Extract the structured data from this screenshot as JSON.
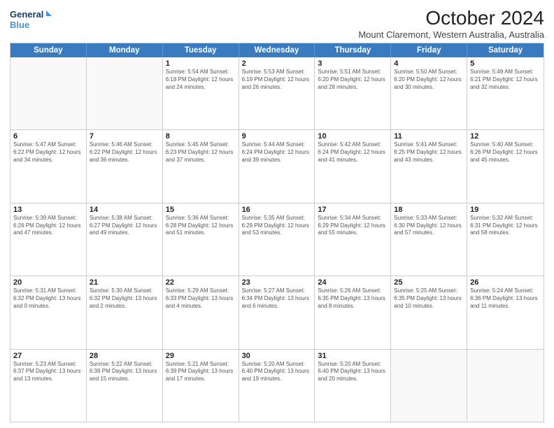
{
  "logo": {
    "line1": "General",
    "line2": "Blue",
    "icon_color": "#4a90d9"
  },
  "title": "October 2024",
  "subtitle": "Mount Claremont, Western Australia, Australia",
  "days": [
    "Sunday",
    "Monday",
    "Tuesday",
    "Wednesday",
    "Thursday",
    "Friday",
    "Saturday"
  ],
  "weeks": [
    [
      {
        "day": "",
        "info": ""
      },
      {
        "day": "",
        "info": ""
      },
      {
        "day": "1",
        "info": "Sunrise: 5:54 AM\nSunset: 6:18 PM\nDaylight: 12 hours and 24 minutes."
      },
      {
        "day": "2",
        "info": "Sunrise: 5:53 AM\nSunset: 6:19 PM\nDaylight: 12 hours and 26 minutes."
      },
      {
        "day": "3",
        "info": "Sunrise: 5:51 AM\nSunset: 6:20 PM\nDaylight: 12 hours and 28 minutes."
      },
      {
        "day": "4",
        "info": "Sunrise: 5:50 AM\nSunset: 6:20 PM\nDaylight: 12 hours and 30 minutes."
      },
      {
        "day": "5",
        "info": "Sunrise: 5:49 AM\nSunset: 6:21 PM\nDaylight: 12 hours and 32 minutes."
      }
    ],
    [
      {
        "day": "6",
        "info": "Sunrise: 5:47 AM\nSunset: 6:22 PM\nDaylight: 12 hours and 34 minutes."
      },
      {
        "day": "7",
        "info": "Sunrise: 5:46 AM\nSunset: 6:22 PM\nDaylight: 12 hours and 36 minutes."
      },
      {
        "day": "8",
        "info": "Sunrise: 5:45 AM\nSunset: 6:23 PM\nDaylight: 12 hours and 37 minutes."
      },
      {
        "day": "9",
        "info": "Sunrise: 5:44 AM\nSunset: 6:24 PM\nDaylight: 12 hours and 39 minutes."
      },
      {
        "day": "10",
        "info": "Sunrise: 5:42 AM\nSunset: 6:24 PM\nDaylight: 12 hours and 41 minutes."
      },
      {
        "day": "11",
        "info": "Sunrise: 5:41 AM\nSunset: 6:25 PM\nDaylight: 12 hours and 43 minutes."
      },
      {
        "day": "12",
        "info": "Sunrise: 5:40 AM\nSunset: 6:26 PM\nDaylight: 12 hours and 45 minutes."
      }
    ],
    [
      {
        "day": "13",
        "info": "Sunrise: 5:39 AM\nSunset: 6:26 PM\nDaylight: 12 hours and 47 minutes."
      },
      {
        "day": "14",
        "info": "Sunrise: 5:38 AM\nSunset: 6:27 PM\nDaylight: 12 hours and 49 minutes."
      },
      {
        "day": "15",
        "info": "Sunrise: 5:36 AM\nSunset: 6:28 PM\nDaylight: 12 hours and 51 minutes."
      },
      {
        "day": "16",
        "info": "Sunrise: 5:35 AM\nSunset: 6:29 PM\nDaylight: 12 hours and 53 minutes."
      },
      {
        "day": "17",
        "info": "Sunrise: 5:34 AM\nSunset: 6:29 PM\nDaylight: 12 hours and 55 minutes."
      },
      {
        "day": "18",
        "info": "Sunrise: 5:33 AM\nSunset: 6:30 PM\nDaylight: 12 hours and 57 minutes."
      },
      {
        "day": "19",
        "info": "Sunrise: 5:32 AM\nSunset: 6:31 PM\nDaylight: 12 hours and 58 minutes."
      }
    ],
    [
      {
        "day": "20",
        "info": "Sunrise: 5:31 AM\nSunset: 6:32 PM\nDaylight: 13 hours and 0 minutes."
      },
      {
        "day": "21",
        "info": "Sunrise: 5:30 AM\nSunset: 6:32 PM\nDaylight: 13 hours and 2 minutes."
      },
      {
        "day": "22",
        "info": "Sunrise: 5:29 AM\nSunset: 6:33 PM\nDaylight: 13 hours and 4 minutes."
      },
      {
        "day": "23",
        "info": "Sunrise: 5:27 AM\nSunset: 6:34 PM\nDaylight: 13 hours and 6 minutes."
      },
      {
        "day": "24",
        "info": "Sunrise: 5:26 AM\nSunset: 6:35 PM\nDaylight: 13 hours and 8 minutes."
      },
      {
        "day": "25",
        "info": "Sunrise: 5:25 AM\nSunset: 6:35 PM\nDaylight: 13 hours and 10 minutes."
      },
      {
        "day": "26",
        "info": "Sunrise: 5:24 AM\nSunset: 6:36 PM\nDaylight: 13 hours and 11 minutes."
      }
    ],
    [
      {
        "day": "27",
        "info": "Sunrise: 5:23 AM\nSunset: 6:37 PM\nDaylight: 13 hours and 13 minutes."
      },
      {
        "day": "28",
        "info": "Sunrise: 5:22 AM\nSunset: 6:38 PM\nDaylight: 13 hours and 15 minutes."
      },
      {
        "day": "29",
        "info": "Sunrise: 5:21 AM\nSunset: 6:39 PM\nDaylight: 13 hours and 17 minutes."
      },
      {
        "day": "30",
        "info": "Sunrise: 5:20 AM\nSunset: 6:40 PM\nDaylight: 13 hours and 19 minutes."
      },
      {
        "day": "31",
        "info": "Sunrise: 5:20 AM\nSunset: 6:40 PM\nDaylight: 13 hours and 20 minutes."
      },
      {
        "day": "",
        "info": ""
      },
      {
        "day": "",
        "info": ""
      }
    ]
  ]
}
